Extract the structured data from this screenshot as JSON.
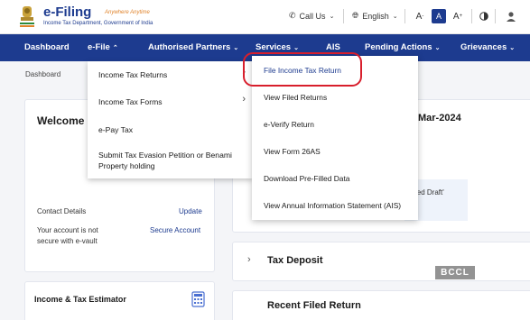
{
  "header": {
    "logo_title": "e-Filing",
    "logo_tagline": "Anywhere Anytime",
    "logo_subtitle": "Income Tax Department, Government of India",
    "call_us": "Call Us",
    "language": "English",
    "font_decrease": "A",
    "font_normal": "A",
    "font_increase": "A"
  },
  "nav": {
    "items": [
      {
        "label": "Dashboard"
      },
      {
        "label": "e-File"
      },
      {
        "label": "Authorised Partners"
      },
      {
        "label": "Services"
      },
      {
        "label": "AIS"
      },
      {
        "label": "Pending Actions"
      },
      {
        "label": "Grievances"
      }
    ]
  },
  "breadcrumb": "Dashboard",
  "welcome": {
    "title": "Welcome B",
    "contact_label": "Contact Details",
    "update_link": "Update",
    "vault_text_line1": "Your account is not",
    "vault_text_line2": "secure with e-vault",
    "secure_link": "Secure Account"
  },
  "estimator": {
    "title": "Income & Tax Estimator"
  },
  "right_panel": {
    "date_fragment": "Mar-2024",
    "draft_fragment": "wed Draft'",
    "tax_deposit": "Tax Deposit",
    "bottom_fragment": "Recent Filed Return"
  },
  "efile_menu": {
    "items": [
      {
        "label": "Income Tax Returns",
        "has_submenu": true
      },
      {
        "label": "Income Tax Forms",
        "has_submenu": true
      },
      {
        "label": "e-Pay Tax",
        "has_submenu": false
      },
      {
        "label_line1": "Submit Tax Evasion Petition or Benami",
        "label_line2": "Property holding",
        "has_submenu": false
      }
    ]
  },
  "returns_submenu": {
    "items": [
      {
        "label": "File Income Tax Return"
      },
      {
        "label": "View Filed Returns"
      },
      {
        "label": "e-Verify Return"
      },
      {
        "label": "View Form 26AS"
      },
      {
        "label": "Download Pre-Filled Data"
      },
      {
        "label": "View Annual Information Statement (AIS)"
      }
    ]
  },
  "watermark": "BCCL",
  "colors": {
    "brand": "#1d3b8f",
    "highlight_ring": "#d81e2c",
    "accent_orange": "#e0832a"
  }
}
